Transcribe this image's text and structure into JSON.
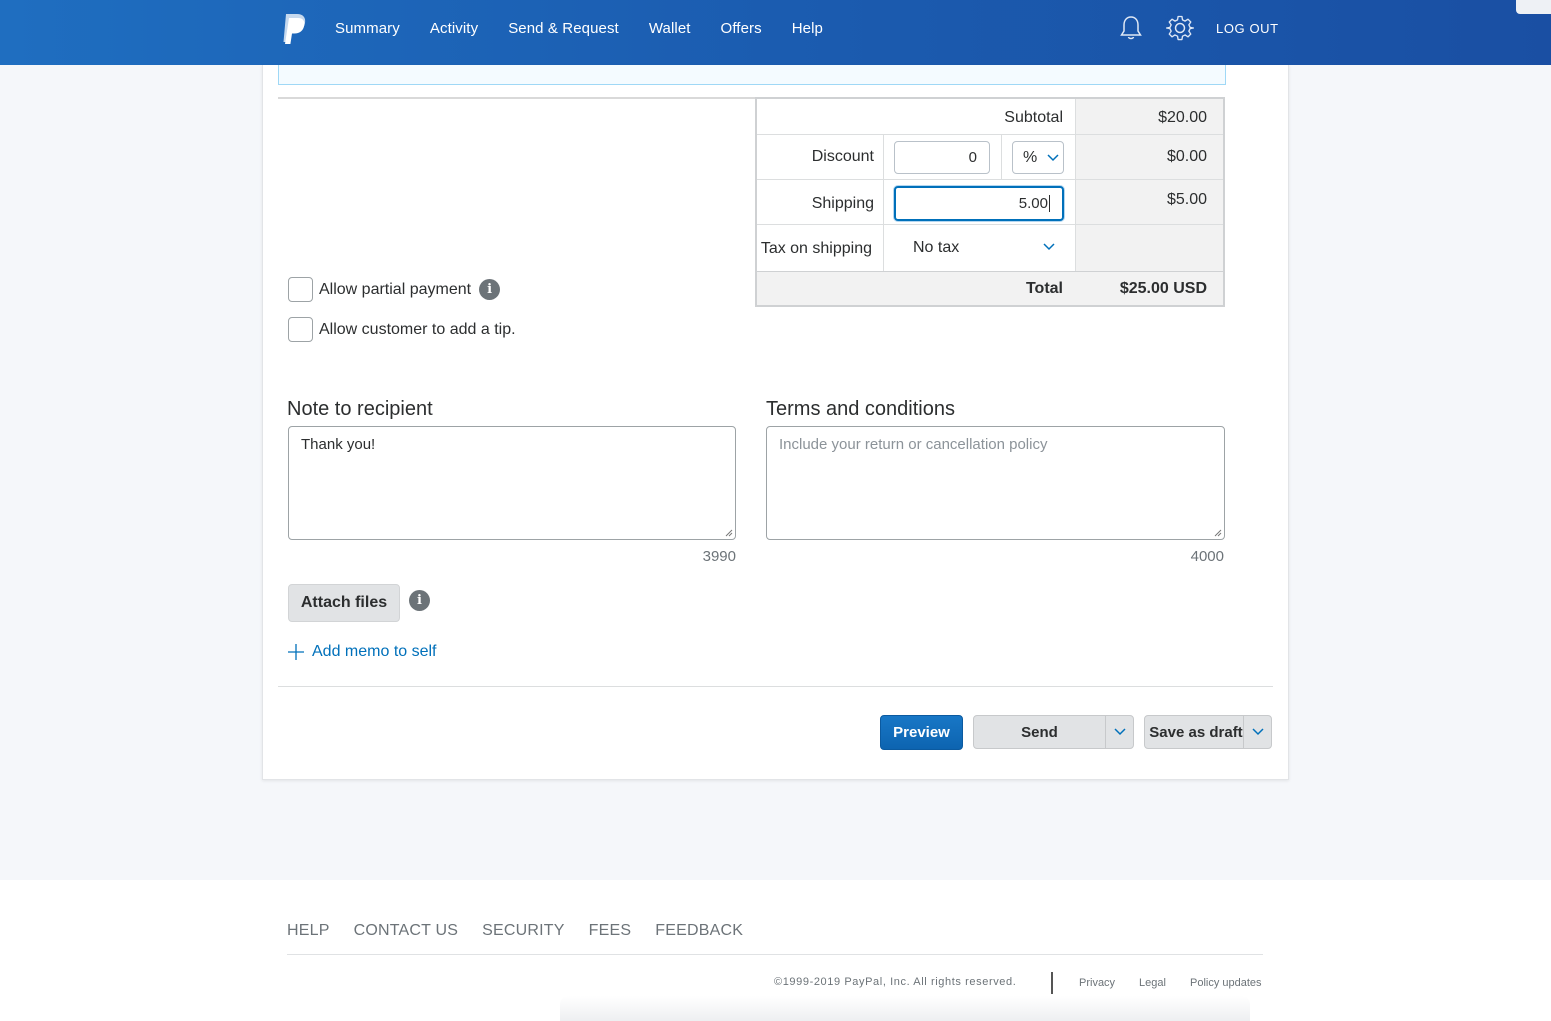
{
  "header": {
    "nav": [
      "Summary",
      "Activity",
      "Send & Request",
      "Wallet",
      "Offers",
      "Help"
    ],
    "logout": "LOG OUT"
  },
  "totals": {
    "subtotal_label": "Subtotal",
    "subtotal_value": "$20.00",
    "discount_label": "Discount",
    "discount_input": "0",
    "discount_unit": "%",
    "discount_value": "$0.00",
    "shipping_label": "Shipping",
    "shipping_input": "5.00",
    "shipping_value": "$5.00",
    "tax_label": "Tax on shipping",
    "tax_select": "No tax",
    "total_label": "Total",
    "total_value": "$25.00 USD"
  },
  "options": {
    "partial_payment": "Allow partial payment",
    "tip": "Allow customer to add a tip."
  },
  "note": {
    "title": "Note to recipient",
    "value": "Thank you!",
    "count": "3990"
  },
  "terms": {
    "title": "Terms and conditions",
    "placeholder": "Include your return or cancellation policy",
    "count": "4000"
  },
  "attach_label": "Attach files",
  "memo_label": "Add memo to self",
  "actions": {
    "preview": "Preview",
    "send": "Send",
    "save_draft": "Save as draft"
  },
  "footer": {
    "links": [
      "HELP",
      "CONTACT US",
      "SECURITY",
      "FEES",
      "FEEDBACK"
    ],
    "copyright": "©1999-2019 PayPal, Inc. All rights reserved.",
    "legal": [
      "Privacy",
      "Legal",
      "Policy updates"
    ]
  },
  "colors": {
    "brand_blue": "#0070ba",
    "header_blue": "#1b5cb0"
  }
}
